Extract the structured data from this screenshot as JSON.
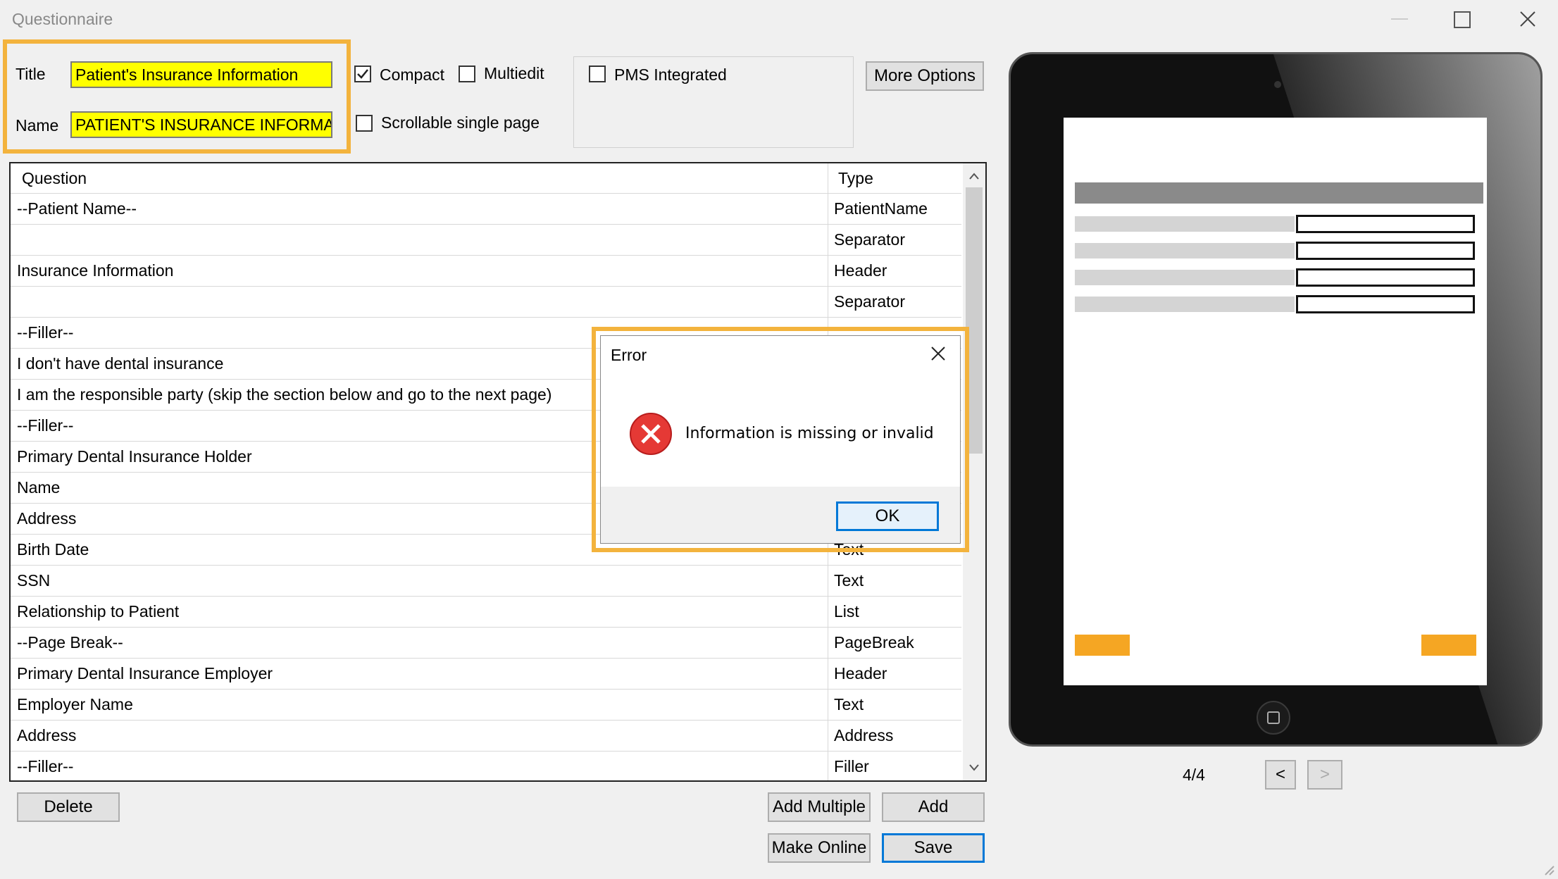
{
  "window": {
    "title": "Questionnaire"
  },
  "fields": {
    "title_label": "Title",
    "title_value": "Patient's Insurance Information",
    "name_label": "Name",
    "name_value": "PATIENT'S INSURANCE INFORMAT"
  },
  "options": {
    "compact_label": "Compact",
    "compact_checked": true,
    "multiedit_label": "Multiedit",
    "multiedit_checked": false,
    "scrollable_label": "Scrollable single page",
    "scrollable_checked": false,
    "pms_label": "PMS Integrated",
    "pms_checked": false,
    "more_options_label": "More Options"
  },
  "table": {
    "headers": {
      "question": "Question",
      "type": "Type"
    },
    "rows": [
      {
        "question": "--Patient Name--",
        "type": "PatientName"
      },
      {
        "question": "",
        "type": "Separator"
      },
      {
        "question": "Insurance Information",
        "type": "Header"
      },
      {
        "question": "",
        "type": "Separator"
      },
      {
        "question": "--Filler--",
        "type": ""
      },
      {
        "question": "I don't have dental insurance",
        "type": ""
      },
      {
        "question": "I am the responsible party (skip the section below and go to the next page)",
        "type": ""
      },
      {
        "question": "--Filler--",
        "type": ""
      },
      {
        "question": "Primary Dental Insurance Holder",
        "type": ""
      },
      {
        "question": "Name",
        "type": ""
      },
      {
        "question": "Address",
        "type": ""
      },
      {
        "question": "Birth Date",
        "type": "Text"
      },
      {
        "question": "SSN",
        "type": "Text"
      },
      {
        "question": "Relationship to Patient",
        "type": "List"
      },
      {
        "question": "--Page Break--",
        "type": "PageBreak"
      },
      {
        "question": "Primary Dental Insurance Employer",
        "type": "Header"
      },
      {
        "question": "Employer Name",
        "type": "Text"
      },
      {
        "question": "Address",
        "type": "Address"
      },
      {
        "question": "--Filler--",
        "type": "Filler"
      }
    ]
  },
  "buttons": {
    "delete": "Delete",
    "add_multiple": "Add Multiple",
    "add": "Add",
    "make_online": "Make Online",
    "save": "Save"
  },
  "preview": {
    "page_indicator": "4/4",
    "prev": "<",
    "next": ">"
  },
  "dialog": {
    "title": "Error",
    "message": "Information is missing or invalid",
    "ok": "OK"
  },
  "colors": {
    "highlight": "#f3b33d",
    "field_bg": "#ffff00",
    "error": "#e53935",
    "accent": "#f5a623"
  }
}
